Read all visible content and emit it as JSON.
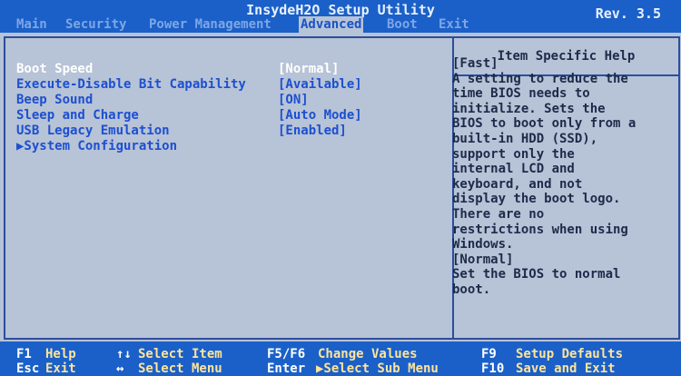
{
  "header": {
    "title": "InsydeH2O Setup Utility",
    "revision": "Rev. 3.5",
    "menu": [
      "Main",
      "Security",
      "Power Management",
      "Advanced",
      "Boot",
      "Exit"
    ]
  },
  "settings": [
    {
      "label": "Boot Speed",
      "value": "[Normal]",
      "selected": true
    },
    {
      "label": "Execute-Disable Bit Capability",
      "value": "[Available]"
    },
    {
      "label": "Beep Sound",
      "value": "[ON]"
    },
    {
      "label": "Sleep and Charge",
      "value": "[Auto Mode]"
    },
    {
      "label": "USB Legacy Emulation",
      "value": "[Enabled]"
    },
    {
      "label": "▶System Configuration",
      "value": ""
    }
  ],
  "help": {
    "title": "Item Specific Help",
    "lines": [
      "[Fast]",
      "A setting to reduce the",
      "time BIOS needs to",
      "initialize. Sets the",
      "BIOS to boot only from a",
      "built-in HDD (SSD),",
      "support only the",
      "internal LCD and",
      "keyboard, and not",
      "display the boot logo.",
      "There are no",
      "restrictions when using",
      "Windows.",
      "[Normal]",
      "Set the BIOS to normal",
      "boot."
    ]
  },
  "footer": {
    "f1_key": "F1",
    "f1_desc": "Help",
    "esc_key": "Esc",
    "esc_desc": "Exit",
    "arrows_ud_key": "↑↓",
    "arrows_ud_desc": "Select Item",
    "arrows_lr_key": "↔",
    "arrows_lr_desc": "Select Menu",
    "f5f6_key": "F5/F6",
    "f5f6_desc": "Change Values",
    "enter_key": "Enter",
    "enter_desc": "▶Select Sub Menu",
    "f9_key": "F9",
    "f9_desc": "Setup Defaults",
    "f10_key": "F10",
    "f10_desc": "Save and Exit"
  }
}
